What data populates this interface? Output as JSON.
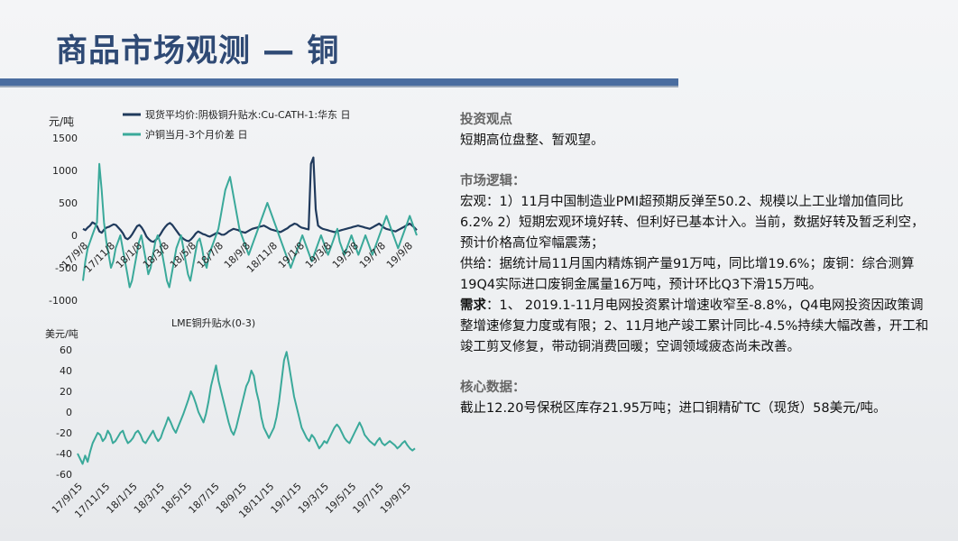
{
  "title": "商品市场观测 — 铜",
  "colors": {
    "title": "#2f4a75",
    "bar": "#4a6da0",
    "series_dark": "#203a5c",
    "series_teal": "#3aa99a"
  },
  "chart_data": [
    {
      "type": "line",
      "ylabel": "元/吨",
      "ylim": [
        -1000,
        1500
      ],
      "yticks": [
        "1500",
        "1000",
        "500",
        "0",
        "-500",
        "-1000"
      ],
      "xticks": [
        "17/9/8",
        "17/11/8",
        "18/1/8",
        "18/3/8",
        "18/5/8",
        "18/7/8",
        "18/9/8",
        "18/11/8",
        "19/1/8",
        "19/3/8",
        "19/5/8",
        "19/7/8",
        "19/9/8"
      ],
      "series": [
        {
          "name": "现货平均价:阴极铜升贴水:Cu-CATH-1:华东 日",
          "values": [
            100,
            80,
            120,
            150,
            200,
            180,
            140,
            60,
            40,
            90,
            120,
            130,
            150,
            170,
            160,
            120,
            80,
            30,
            -40,
            -60,
            -30,
            20,
            80,
            140,
            160,
            120,
            60,
            -20,
            -60,
            -90,
            -100,
            -70,
            -30,
            20,
            80,
            130,
            170,
            190,
            160,
            110,
            60,
            10,
            -30,
            -60,
            -80,
            -90,
            -60,
            -20,
            30,
            60,
            40,
            20,
            10,
            -10,
            -20,
            0,
            20,
            40,
            30,
            10,
            10,
            30,
            60,
            80,
            100,
            90,
            80,
            60,
            50,
            40,
            60,
            80,
            100,
            110,
            120,
            130,
            140,
            150,
            130,
            110,
            90,
            80,
            70,
            60,
            50,
            70,
            90,
            110,
            140,
            160,
            180,
            170,
            140,
            120,
            110,
            100,
            90,
            1100,
            1200,
            400,
            150,
            120,
            100,
            90,
            80,
            70,
            60,
            50,
            60,
            70,
            80,
            90,
            100,
            110,
            120,
            130,
            140,
            150,
            140,
            130,
            120,
            110,
            100,
            120,
            140,
            160,
            180,
            150,
            120,
            100,
            90,
            80,
            70,
            60,
            80,
            100,
            120,
            140,
            160,
            180,
            150,
            120,
            80
          ]
        },
        {
          "name": "沪铜当月-3个月价差 日",
          "values": [
            -700,
            -400,
            -200,
            -100,
            0,
            100,
            200,
            1100,
            700,
            200,
            -100,
            -300,
            -500,
            -400,
            -200,
            -100,
            0,
            -200,
            -400,
            -600,
            -800,
            -700,
            -500,
            -300,
            -100,
            0,
            -200,
            -400,
            -600,
            -500,
            -300,
            -100,
            0,
            -100,
            -300,
            -500,
            -700,
            -800,
            -600,
            -400,
            -200,
            -100,
            0,
            -200,
            -400,
            -600,
            -700,
            -500,
            -300,
            -100,
            -50,
            -200,
            -400,
            -500,
            -300,
            -200,
            -100,
            0,
            100,
            300,
            500,
            700,
            800,
            900,
            700,
            500,
            300,
            100,
            0,
            -100,
            -200,
            -300,
            -200,
            -100,
            0,
            100,
            200,
            300,
            400,
            500,
            400,
            300,
            200,
            100,
            0,
            -100,
            -200,
            -300,
            -400,
            -500,
            -400,
            -300,
            -200,
            -100,
            0,
            -100,
            -200,
            -300,
            -400,
            -300,
            -200,
            -100,
            0,
            -100,
            -200,
            -300,
            -200,
            -100,
            0,
            100,
            -100,
            -200,
            -300,
            -200,
            -100,
            0,
            -100,
            -200,
            -300,
            -200,
            -100,
            0,
            -100,
            -200,
            -300,
            -200,
            -100,
            0,
            100,
            200,
            300,
            200,
            100,
            0,
            -100,
            -200,
            -100,
            0,
            100,
            200,
            300,
            200,
            100,
            0
          ]
        }
      ]
    },
    {
      "type": "line",
      "title": "LME铜升贴水(0-3)",
      "ylabel": "美元/吨",
      "ylim": [
        -60,
        60
      ],
      "yticks": [
        "60",
        "40",
        "20",
        "0",
        "-20",
        "-40",
        "-60"
      ],
      "xticks": [
        "17/9/15",
        "17/11/15",
        "18/1/15",
        "18/3/15",
        "18/5/15",
        "18/7/15",
        "18/9/15",
        "18/11/15",
        "19/1/15",
        "19/3/15",
        "19/5/15",
        "19/7/15",
        "19/9/15"
      ],
      "series": [
        {
          "name": "LME铜升贴水(0-3)",
          "values": [
            -40,
            -45,
            -50,
            -42,
            -48,
            -38,
            -30,
            -25,
            -20,
            -22,
            -28,
            -25,
            -18,
            -22,
            -30,
            -28,
            -24,
            -20,
            -18,
            -25,
            -30,
            -28,
            -25,
            -20,
            -18,
            -22,
            -28,
            -30,
            -26,
            -22,
            -18,
            -24,
            -28,
            -25,
            -18,
            -12,
            -5,
            -10,
            -16,
            -20,
            -14,
            -8,
            -2,
            5,
            12,
            20,
            15,
            8,
            0,
            -5,
            -10,
            -2,
            10,
            25,
            35,
            45,
            30,
            20,
            10,
            0,
            -10,
            -18,
            -22,
            -15,
            -5,
            5,
            15,
            25,
            30,
            40,
            35,
            20,
            10,
            -5,
            -15,
            -20,
            -25,
            -20,
            -15,
            -5,
            10,
            30,
            50,
            58,
            45,
            30,
            15,
            5,
            -5,
            -15,
            -20,
            -25,
            -28,
            -22,
            -25,
            -30,
            -35,
            -32,
            -28,
            -30,
            -25,
            -20,
            -15,
            -12,
            -15,
            -20,
            -25,
            -28,
            -30,
            -25,
            -20,
            -15,
            -10,
            -15,
            -22,
            -25,
            -28,
            -30,
            -32,
            -28,
            -25,
            -30,
            -32,
            -30,
            -28,
            -30,
            -32,
            -35,
            -33,
            -30,
            -28,
            -32,
            -35,
            -37,
            -35
          ]
        }
      ]
    }
  ],
  "sections": {
    "view": {
      "heading": "投资观点",
      "text": "短期高位盘整、暂观望。"
    },
    "logic": {
      "heading": "市场逻辑：",
      "macro": "宏观：1）11月中国制造业PMI超预期反弹至50.2、规模以上工业增加值同比6.2% 2）短期宏观环境好转、但利好已基本计入。当前，数据好转及暂乏利空，预计价格高位窄幅震荡；",
      "supply": "供给：据统计局11月国内精炼铜产量91万吨，同比增19.6%；废铜：综合测算19Q4实际进口废铜金属量16万吨，预计环比Q3下滑15万吨。",
      "demand_label": "需求",
      "demand": "：1、 2019.1-11月电网投资累计增速收窄至-8.8%，Q4电网投资因政策调整增速修复力度或有限；2、11月地产竣工累计同比-4.5%持续大幅改善，开工和竣工剪叉修复，带动铜消费回暖；空调领域疲态尚未改善。"
    },
    "core": {
      "heading": "核心数据：",
      "text": "截止12.20号保税区库存21.95万吨；进口铜精矿TC（现货）58美元/吨。"
    }
  }
}
